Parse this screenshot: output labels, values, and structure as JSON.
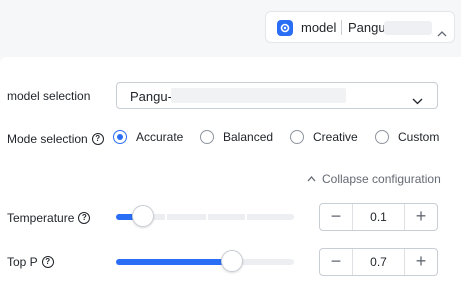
{
  "header": {
    "model_label": "model",
    "model_value": "Pangu-"
  },
  "model_selection": {
    "label": "model selection",
    "value": "Pangu-"
  },
  "mode_selection": {
    "label": "Mode selection",
    "options": [
      "Accurate",
      "Balanced",
      "Creative",
      "Custom"
    ],
    "selected": "Accurate"
  },
  "collapse_label": "Collapse configuration",
  "temperature": {
    "label": "Temperature",
    "value": "0.1",
    "fraction": 0.15
  },
  "top_p": {
    "label": "Top P",
    "value": "0.7",
    "fraction": 0.65
  },
  "colors": {
    "accent": "#2b6ef6",
    "text": "#1f2329",
    "muted": "#646a73"
  },
  "icons": [
    "model-logo-icon",
    "chevron-up-icon",
    "chevron-down-icon",
    "help-icon"
  ]
}
